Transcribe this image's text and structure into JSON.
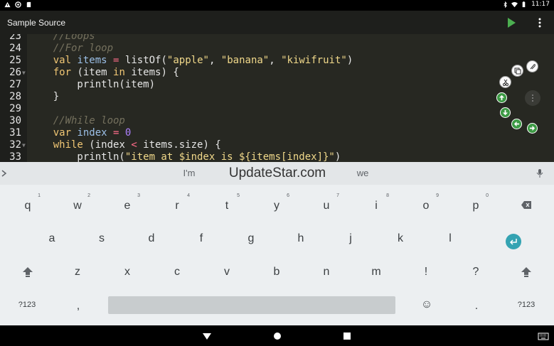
{
  "status_bar": {
    "time": "11:17"
  },
  "app_bar": {
    "title": "Sample Source"
  },
  "editor": {
    "lines": [
      {
        "num": "23",
        "tokens": [
          {
            "t": "    ",
            "c": "tp"
          },
          {
            "t": "//Loops",
            "c": "cm"
          }
        ]
      },
      {
        "num": "24",
        "tokens": [
          {
            "t": "    ",
            "c": "tp"
          },
          {
            "t": "//For loop",
            "c": "cm"
          }
        ]
      },
      {
        "num": "25",
        "tokens": [
          {
            "t": "    ",
            "c": "tp"
          },
          {
            "t": "val",
            "c": "kw"
          },
          {
            "t": " ",
            "c": "tp"
          },
          {
            "t": "items",
            "c": "id"
          },
          {
            "t": " ",
            "c": "tp"
          },
          {
            "t": "=",
            "c": "op"
          },
          {
            "t": " listOf(",
            "c": "tp"
          },
          {
            "t": "\"apple\"",
            "c": "st"
          },
          {
            "t": ", ",
            "c": "tp"
          },
          {
            "t": "\"banana\"",
            "c": "st"
          },
          {
            "t": ", ",
            "c": "tp"
          },
          {
            "t": "\"kiwifruit\"",
            "c": "st"
          },
          {
            "t": ")",
            "c": "tp"
          }
        ]
      },
      {
        "num": "26",
        "fold": true,
        "tokens": [
          {
            "t": "    ",
            "c": "tp"
          },
          {
            "t": "for",
            "c": "kw"
          },
          {
            "t": " (item ",
            "c": "tp"
          },
          {
            "t": "in",
            "c": "kw"
          },
          {
            "t": " items) {",
            "c": "tp"
          }
        ]
      },
      {
        "num": "27",
        "tokens": [
          {
            "t": "        println(item)",
            "c": "tp"
          }
        ]
      },
      {
        "num": "28",
        "tokens": [
          {
            "t": "    }",
            "c": "tp"
          }
        ]
      },
      {
        "num": "29",
        "tokens": []
      },
      {
        "num": "30",
        "tokens": [
          {
            "t": "    ",
            "c": "tp"
          },
          {
            "t": "//While loop",
            "c": "cm"
          }
        ]
      },
      {
        "num": "31",
        "tokens": [
          {
            "t": "    ",
            "c": "tp"
          },
          {
            "t": "var",
            "c": "kw"
          },
          {
            "t": " ",
            "c": "tp"
          },
          {
            "t": "index",
            "c": "id"
          },
          {
            "t": " ",
            "c": "tp"
          },
          {
            "t": "=",
            "c": "op"
          },
          {
            "t": " ",
            "c": "tp"
          },
          {
            "t": "0",
            "c": "nm"
          }
        ]
      },
      {
        "num": "32",
        "fold": true,
        "tokens": [
          {
            "t": "    ",
            "c": "tp"
          },
          {
            "t": "while",
            "c": "kw"
          },
          {
            "t": " (index ",
            "c": "tp"
          },
          {
            "t": "<",
            "c": "op"
          },
          {
            "t": " items.size) {",
            "c": "tp"
          }
        ]
      },
      {
        "num": "33",
        "tokens": [
          {
            "t": "        println(",
            "c": "tp"
          },
          {
            "t": "\"item at $index is ${items[index]}\"",
            "c": "st"
          },
          {
            "t": ")",
            "c": "tp"
          }
        ]
      }
    ]
  },
  "tools": {
    "icons": [
      "paste-icon",
      "copy-icon",
      "cut-icon",
      "more-icon",
      "arrow-up-icon",
      "arrow-down-icon",
      "arrow-left-icon",
      "arrow-right-icon"
    ]
  },
  "keyboard": {
    "suggestions": {
      "left": "I'm",
      "middle": "UpdateStar.com",
      "right": "we"
    },
    "row1": [
      {
        "k": "q",
        "h": "1"
      },
      {
        "k": "w",
        "h": "2"
      },
      {
        "k": "e",
        "h": "3"
      },
      {
        "k": "r",
        "h": "4"
      },
      {
        "k": "t",
        "h": "5"
      },
      {
        "k": "y",
        "h": "6"
      },
      {
        "k": "u",
        "h": "7"
      },
      {
        "k": "i",
        "h": "8"
      },
      {
        "k": "o",
        "h": "9"
      },
      {
        "k": "p",
        "h": "0"
      }
    ],
    "row2": [
      "a",
      "s",
      "d",
      "f",
      "g",
      "h",
      "j",
      "k",
      "l"
    ],
    "row3": [
      "z",
      "x",
      "c",
      "v",
      "b",
      "n",
      "m",
      "!",
      "?"
    ],
    "row4": {
      "symbols": "?123",
      "comma": ",",
      "emoji": "☺",
      "period": ".",
      "symbols_right": "?123"
    }
  },
  "colors": {
    "editor_bg": "#272822",
    "appbar_bg": "#1e1f1c",
    "run_green": "#4caf50",
    "enter_teal": "#34a3b2",
    "tool_green": "#3c9a44"
  }
}
